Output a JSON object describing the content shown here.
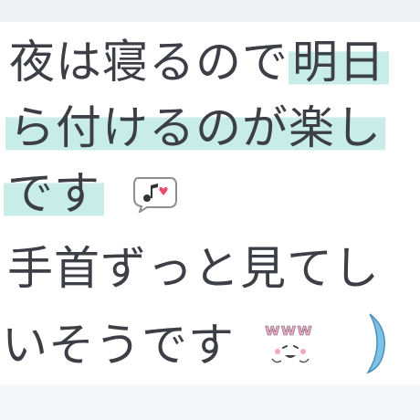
{
  "message": {
    "lines": [
      {
        "text": "夜は寝るので",
        "highlight": "明日"
      },
      {
        "text": "",
        "highlight": "ら付けるのが楽し"
      },
      {
        "text": "",
        "highlight": "です"
      },
      {
        "text": "手首ずっと見てし",
        "highlight": ""
      },
      {
        "text": "いそうです",
        "highlight": ""
      }
    ],
    "emoji": {
      "music": "music-note-bubble-icon",
      "www": "www",
      "moon": "crescent-moon-icon"
    }
  },
  "colors": {
    "highlight": "#c8ede8",
    "text": "#3c4046",
    "moon": "#7ec2e8"
  }
}
